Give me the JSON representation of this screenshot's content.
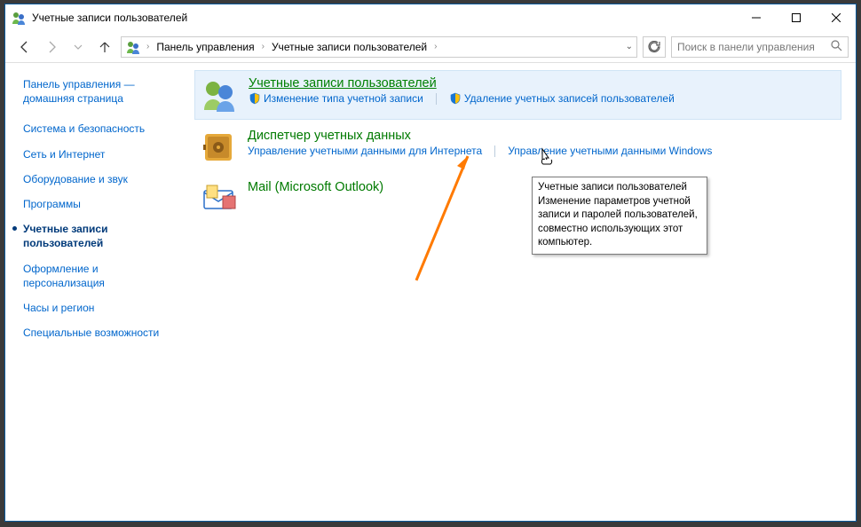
{
  "window": {
    "title": "Учетные записи пользователей"
  },
  "breadcrumb": {
    "root": "Панель управления",
    "section": "Учетные записи пользователей"
  },
  "search": {
    "placeholder": "Поиск в панели управления"
  },
  "sidebar": {
    "home": "Панель управления — домашняя страница",
    "items": [
      "Система и безопасность",
      "Сеть и Интернет",
      "Оборудование и звук",
      "Программы",
      "Учетные записи пользователей",
      "Оформление и персонализация",
      "Часы и регион",
      "Специальные возможности"
    ]
  },
  "content": {
    "cat1": {
      "title": "Учетные записи пользователей",
      "sub1": "Изменение типа учетной записи",
      "sub2": "Удаление учетных записей пользователей"
    },
    "cat2": {
      "title": "Диспетчер учетных данных",
      "sub1": "Управление учетными данными для Интернета",
      "sub2": "Управление учетными данными Windows"
    },
    "cat3": {
      "title": "Mail (Microsoft Outlook)"
    }
  },
  "tooltip": {
    "title": "Учетные записи пользователей",
    "body": "Изменение параметров учетной записи и паролей пользователей, совместно использующих этот компьютер."
  }
}
